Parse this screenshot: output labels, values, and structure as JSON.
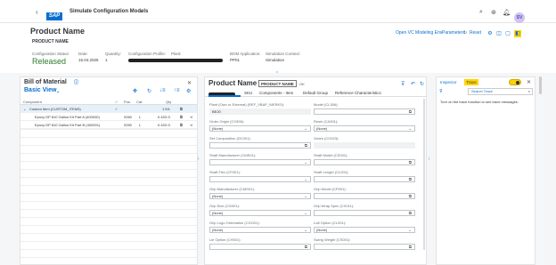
{
  "shell": {
    "logo": "SAP",
    "title": "Simulate Configuration Models",
    "avatar": "SV"
  },
  "header": {
    "product_name": "Product Name",
    "product_code": "PRODUCT NAME",
    "actions": {
      "open_vc": "Open VC Modeling Env.",
      "parameters": "Parameters",
      "reset": "Reset"
    },
    "attributes": [
      {
        "label": "Configuration Status:",
        "value": "Released"
      },
      {
        "label": "Date:",
        "value": "15.04.2025"
      },
      {
        "label": "Quantity:",
        "value": "1"
      },
      {
        "label": "Configuration Profile:",
        "value": ""
      },
      {
        "label": "Plant:",
        "value": ""
      },
      {
        "label": "BOM Application:",
        "value": "PP01"
      },
      {
        "label": "Simulation Context:",
        "value": "Simulation"
      }
    ]
  },
  "bom": {
    "title": "Bill of Material",
    "view": "Basic View",
    "columns": {
      "component": "Component",
      "pos": "Pos.",
      "cat": "Cat.",
      "qty": "Qty"
    },
    "rows": [
      {
        "component": "Custom Item (CUSTOM_ITEM3)",
        "pos": "",
        "cat": "",
        "qty": "1 EA"
      },
      {
        "component": "Epoxy DP 810 Gallon Kit Part A (400000)",
        "pos": "0260",
        "cat": "L",
        "qty": "0.433 G"
      },
      {
        "component": "Epoxy DP 810 Gallon Kit Part B (400001)",
        "pos": "0250",
        "cat": "L",
        "qty": "0.433 G"
      }
    ]
  },
  "config": {
    "title": "Product Name",
    "chip": "PRODUCT NAME",
    "status": "OK",
    "tabs": [
      "",
      "SKU",
      "Components - Item",
      "Default Group",
      "Reference Characteristics"
    ],
    "fields": [
      {
        "label": "Plant (Own or External) (REF_VBAP_WERKS):",
        "value": "BE20",
        "readonly": true,
        "trigger": ""
      },
      {
        "label": "Model (CL306):",
        "value": "",
        "readonly": false,
        "trigger": "⧉"
      },
      {
        "label": "Order Origin (CX306):",
        "value": "(None)",
        "readonly": false,
        "trigger": "⌄"
      },
      {
        "label": "Resin (CA301):",
        "value": "(None)",
        "readonly": false,
        "trigger": "⌄"
      },
      {
        "label": "Set Composition (DC001):",
        "value": "",
        "readonly": false,
        "trigger": "⧉"
      },
      {
        "label": "Gears (CO023):",
        "value": "",
        "readonly": true,
        "trigger": ""
      },
      {
        "label": "Shaft Manufacturer (CMS01):",
        "value": "",
        "readonly": false,
        "trigger": "⌄"
      },
      {
        "label": "Shaft Model (CS001):",
        "value": "",
        "readonly": false,
        "trigger": "⧉"
      },
      {
        "label": "Shaft Flex (CF001):",
        "value": "",
        "readonly": false,
        "trigger": "⌄"
      },
      {
        "label": "Shaft Length (CL001):",
        "value": "",
        "readonly": false,
        "trigger": "⧉"
      },
      {
        "label": "Grip Manufacturer (CMG01):",
        "value": "(None)",
        "readonly": false,
        "trigger": "⌄"
      },
      {
        "label": "Grip Model (CP001):",
        "value": "",
        "readonly": false,
        "trigger": "⧉"
      },
      {
        "label": "Grip Size (CG001):",
        "value": "(None)",
        "readonly": false,
        "trigger": "⌄"
      },
      {
        "label": "Grip Wrap Spec (CX011):",
        "value": "",
        "readonly": false,
        "trigger": "⧉"
      },
      {
        "label": "Grip Logo Orientation (CGO01):",
        "value": "(None)",
        "readonly": false,
        "trigger": "⌄"
      },
      {
        "label": "Loft Option (CL001):",
        "value": "(None)",
        "readonly": false,
        "trigger": "⌄"
      },
      {
        "label": "Lie Option (CH001):",
        "value": "",
        "readonly": false,
        "trigger": "⧉"
      },
      {
        "label": "Swing Weight (CS001):",
        "value": "",
        "readonly": false,
        "trigger": "⧉"
      }
    ]
  },
  "inspector": {
    "tab_inspector": "Inspector",
    "tab_trace": "Trace",
    "search_placeholder": "Search Trace",
    "hint": "Turn on the trace function to see trace messages."
  }
}
